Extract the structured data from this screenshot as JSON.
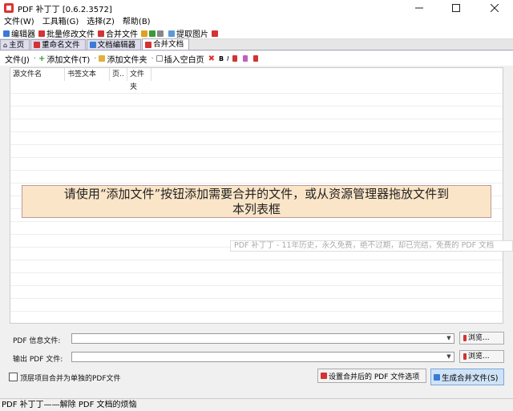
{
  "window": {
    "title": "PDF 补丁丁 [0.6.2.3572]"
  },
  "menu": [
    "文件(W)",
    "工具箱(G)",
    "选择(Z)",
    "帮助(B)"
  ],
  "toolbar": {
    "editor": "编辑器",
    "batch_edit": "批量修改文件",
    "merge": "合并文件",
    "extract_images": "提取图片"
  },
  "tabs": [
    "主页",
    "重命名文件",
    "文档编辑器",
    "合并文档"
  ],
  "subtoolbar": {
    "file": "文件(J)",
    "add_file": "添加文件(T)",
    "add_folder": "添加文件夹",
    "insert_blank": "插入空白页",
    "bold": "B",
    "italic": "I"
  },
  "columns": [
    "源文件名",
    "书签文本",
    "页..",
    "文件夹"
  ],
  "hint": {
    "line1": "请使用“添加文件”按钮添加需要合并的文件，或从资源管理器拖放文件到",
    "line2": "本列表框"
  },
  "watermark": "PDF 补丁丁 - 11年历史，永久免费，绝不过期，却已完结，免费的 PDF 文档",
  "fields": {
    "info_label": "PDF 信息文件:",
    "output_label": "输出 PDF 文件:",
    "browse": "浏览..."
  },
  "bottom": {
    "checkbox_label": "顶层项目合并为单独的PDF文件",
    "options_button": "设置合并后的 PDF 文件选项",
    "generate_button": "生成合并文件(S)"
  },
  "status": "PDF 补丁丁——解除 PDF 文档的烦恼",
  "colors": {
    "hint_bg": "#fbe5c8",
    "generate_bg": "#cfe3f8",
    "accent_red": "#d33333"
  }
}
